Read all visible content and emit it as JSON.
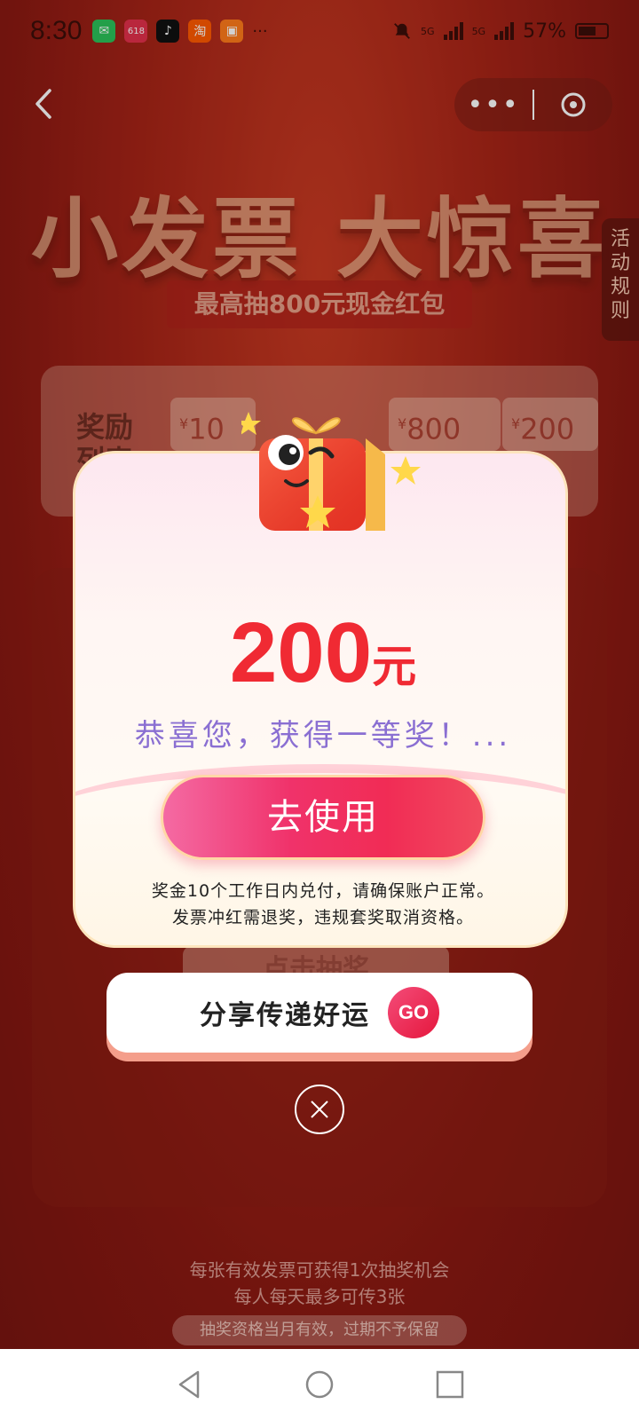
{
  "status_bar": {
    "time": "8:30",
    "apps": [
      {
        "icon": "wechat-icon",
        "color": "#2bc35a",
        "glyph": "✉"
      },
      {
        "icon": "618-app-icon",
        "color": "#e2304b",
        "glyph": "618"
      },
      {
        "icon": "tiktok-icon",
        "color": "#111111",
        "glyph": "♪"
      },
      {
        "icon": "taobao-icon",
        "color": "#ff5a00",
        "glyph": "淘"
      },
      {
        "icon": "shop-app-icon",
        "color": "#ff7a1a",
        "glyph": "▣"
      }
    ],
    "overflow": "···",
    "network1": "5G",
    "network2": "5G",
    "battery": "57%",
    "battery_level": 0.57
  },
  "header": {
    "more_label": "•••"
  },
  "hero": {
    "title": "小发票 大惊喜",
    "subtitle": "最高抽800元现金红包",
    "rules_tab": "活动规则"
  },
  "rewards": {
    "label_line1": "奖励",
    "label_line2": "列表",
    "chips": [
      {
        "currency": "¥",
        "value": "10"
      },
      {
        "currency": "¥",
        "value": "800"
      },
      {
        "currency": "¥",
        "value": "200"
      }
    ]
  },
  "background_button": "点击抽奖",
  "modal": {
    "amount": "200",
    "unit": "元",
    "congrats": "恭喜您，获得一等奖！...",
    "use_button": "去使用",
    "note_line1": "奖金10个工作日内兑付，请确保账户正常。",
    "note_line2": "发票冲红需退奖，违规套奖取消资格。"
  },
  "share": {
    "label": "分享传递好运",
    "go": "GO"
  },
  "footer": {
    "line1": "每张有效发票可获得1次抽奖机会",
    "line2": "每人每天最多可传3张",
    "pill": "抽奖资格当月有效，过期不予保留"
  }
}
